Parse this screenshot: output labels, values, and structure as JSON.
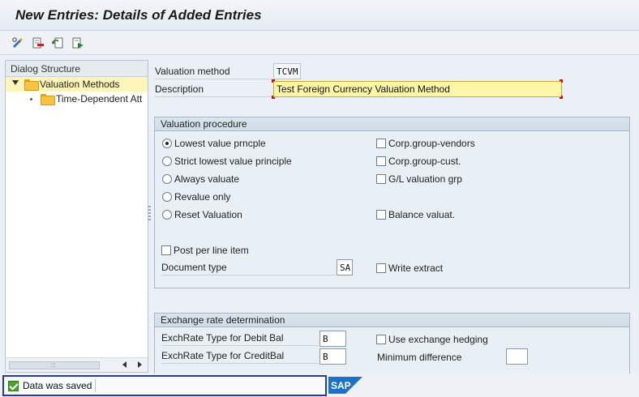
{
  "window": {
    "title": "New Entries: Details of Added Entries"
  },
  "toolbar": {
    "buttons": [
      {
        "name": "display-change-icon"
      },
      {
        "name": "delete-icon"
      },
      {
        "name": "undo-change-icon"
      },
      {
        "name": "next-entry-icon"
      }
    ]
  },
  "dialog_structure": {
    "header": "Dialog Structure",
    "items": [
      {
        "label": "Valuation Methods",
        "selected": true,
        "expanded": true,
        "level": 0
      },
      {
        "label": "Time-Dependent Att",
        "selected": false,
        "expanded": false,
        "level": 1
      }
    ]
  },
  "form": {
    "valuation_method": {
      "label": "Valuation method",
      "value": "TCVM"
    },
    "description": {
      "label": "Description",
      "value": "Test Foreign Currency Valuation Method"
    }
  },
  "valuation_procedure": {
    "title": "Valuation procedure",
    "radios": [
      {
        "label": "Lowest value prncple",
        "selected": true
      },
      {
        "label": "Strict lowest value principle",
        "selected": false
      },
      {
        "label": "Always valuate",
        "selected": false
      },
      {
        "label": "Revalue only",
        "selected": false
      },
      {
        "label": "Reset Valuation",
        "selected": false
      }
    ],
    "checks_right": [
      {
        "label": "Corp.group-vendors",
        "checked": false
      },
      {
        "label": "Corp.group-cust.",
        "checked": false
      },
      {
        "label": "G/L valuation grp",
        "checked": false
      },
      {
        "label": "Balance valuat.",
        "checked": false
      }
    ],
    "post_per_line_item": {
      "label": "Post per line item",
      "checked": false
    },
    "document_type": {
      "label": "Document type",
      "value": "SA"
    },
    "write_extract": {
      "label": "Write extract",
      "checked": false
    }
  },
  "exchange_rate": {
    "title": "Exchange rate determination",
    "debit": {
      "label": "ExchRate Type for Debit Bal",
      "value": "B"
    },
    "credit": {
      "label": "ExchRate Type for CreditBal",
      "value": "B"
    },
    "hedging": {
      "label": "Use exchange hedging",
      "checked": false
    },
    "min_diff": {
      "label": "Minimum difference",
      "value": ""
    }
  },
  "status": {
    "message": "Data was saved",
    "type": "success"
  },
  "brand": {
    "logo": "SAP",
    "color": "#1a73c8"
  }
}
